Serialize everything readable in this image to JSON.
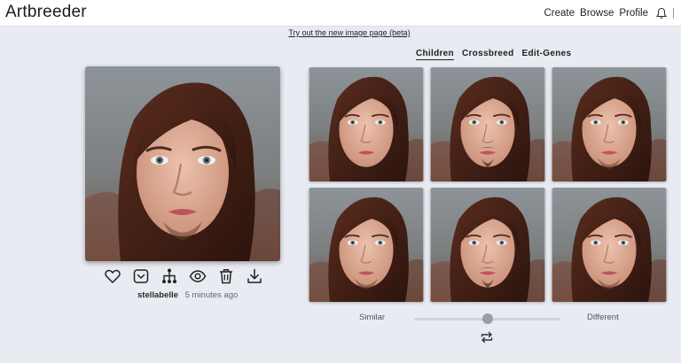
{
  "header": {
    "logo": "Artbreeder",
    "nav": [
      {
        "label": "Create"
      },
      {
        "label": "Browse"
      },
      {
        "label": "Profile"
      }
    ]
  },
  "beta_link": "Try out the new image page (beta)",
  "image": {
    "author": "stellabelle",
    "time": "5 minutes ago"
  },
  "actions": [
    {
      "icon": "heart-icon"
    },
    {
      "icon": "pocket-icon"
    },
    {
      "icon": "lineage-icon"
    },
    {
      "icon": "eye-icon"
    },
    {
      "icon": "trash-icon"
    },
    {
      "icon": "download-icon"
    }
  ],
  "tabs": [
    {
      "label": "Children",
      "active": true
    },
    {
      "label": "Crossbreed",
      "active": false
    },
    {
      "label": "Edit-Genes",
      "active": false
    }
  ],
  "children_count": 6,
  "slider": {
    "left_label": "Similar",
    "right_label": "Different",
    "value": 0.5
  },
  "colors": {
    "background": "#e8ebf1",
    "hair": "#4a2418",
    "skin": "#e2b29d",
    "lips": "#c0525a"
  }
}
